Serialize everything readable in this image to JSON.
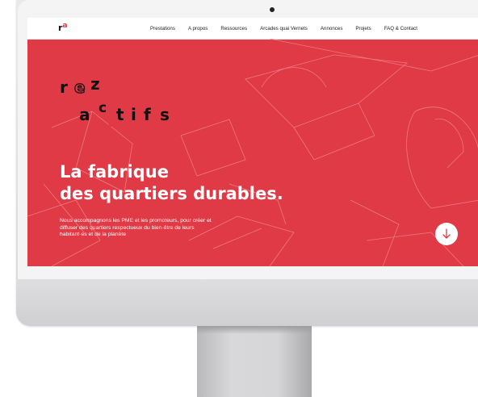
{
  "nav": {
    "logo": {
      "text": "r",
      "accent": "a"
    },
    "items": [
      {
        "label": "Prestations"
      },
      {
        "label": "A propos"
      },
      {
        "label": "Ressources"
      },
      {
        "label": "Arcades quai Vernets"
      },
      {
        "label": "Annonces"
      },
      {
        "label": "Projets"
      },
      {
        "label": "FAQ & Contact"
      }
    ]
  },
  "hero": {
    "brand": {
      "letters": [
        "r",
        "e",
        "z",
        "a",
        "c",
        "t",
        "i",
        "f",
        "s"
      ]
    },
    "headline": {
      "line1": "La fabrique",
      "line2": "des quartiers durables."
    },
    "subtitle": {
      "line1": "Nous accompagnons les PME et les promoteurs, pour créer et",
      "line2": "diffuser des quartiers respectueux du bien-être de leurs",
      "line3": "habitant·es et de la planète"
    },
    "scroll_icon": "arrow-down-icon"
  },
  "colors": {
    "accent": "#df3a45",
    "text_dark": "#111111",
    "nav_bg": "#ffffff"
  }
}
